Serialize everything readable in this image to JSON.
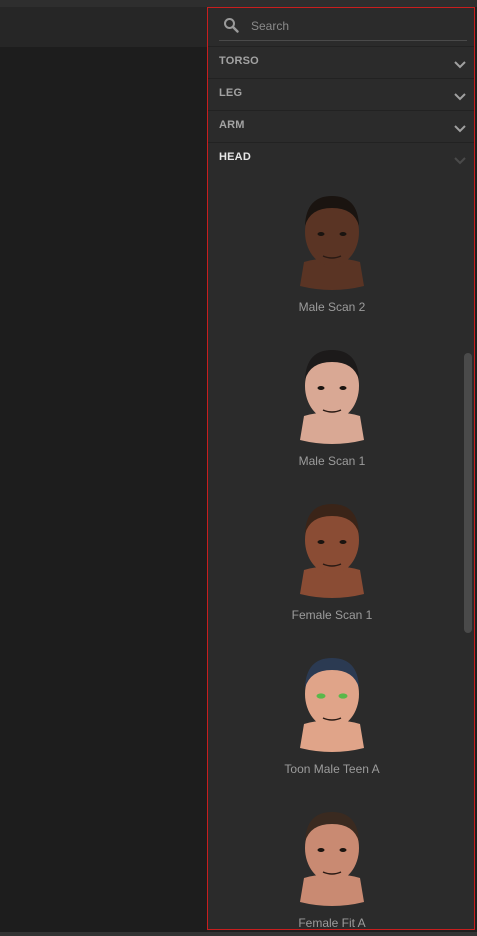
{
  "search": {
    "placeholder": "Search",
    "value": ""
  },
  "categories": [
    {
      "label": "TORSO",
      "expanded": false
    },
    {
      "label": "LEG",
      "expanded": false
    },
    {
      "label": "ARM",
      "expanded": false
    },
    {
      "label": "HEAD",
      "expanded": true
    }
  ],
  "head_items": [
    {
      "label": "Male Scan 2",
      "skin": "#5a3424",
      "hair": "#1a1410"
    },
    {
      "label": "Male Scan 1",
      "skin": "#d9a894",
      "hair": "#1c1a1a"
    },
    {
      "label": "Female Scan 1",
      "skin": "#8a4c34",
      "hair": "#3a2418"
    },
    {
      "label": "Toon Male Teen A",
      "skin": "#e0a489",
      "hair": "#2b3a52"
    },
    {
      "label": "Female Fit A",
      "skin": "#c98a72",
      "hair": "#3a2a20"
    }
  ],
  "colors": {
    "panel_border": "#c81e1e",
    "panel_bg": "#2b2b2b"
  }
}
